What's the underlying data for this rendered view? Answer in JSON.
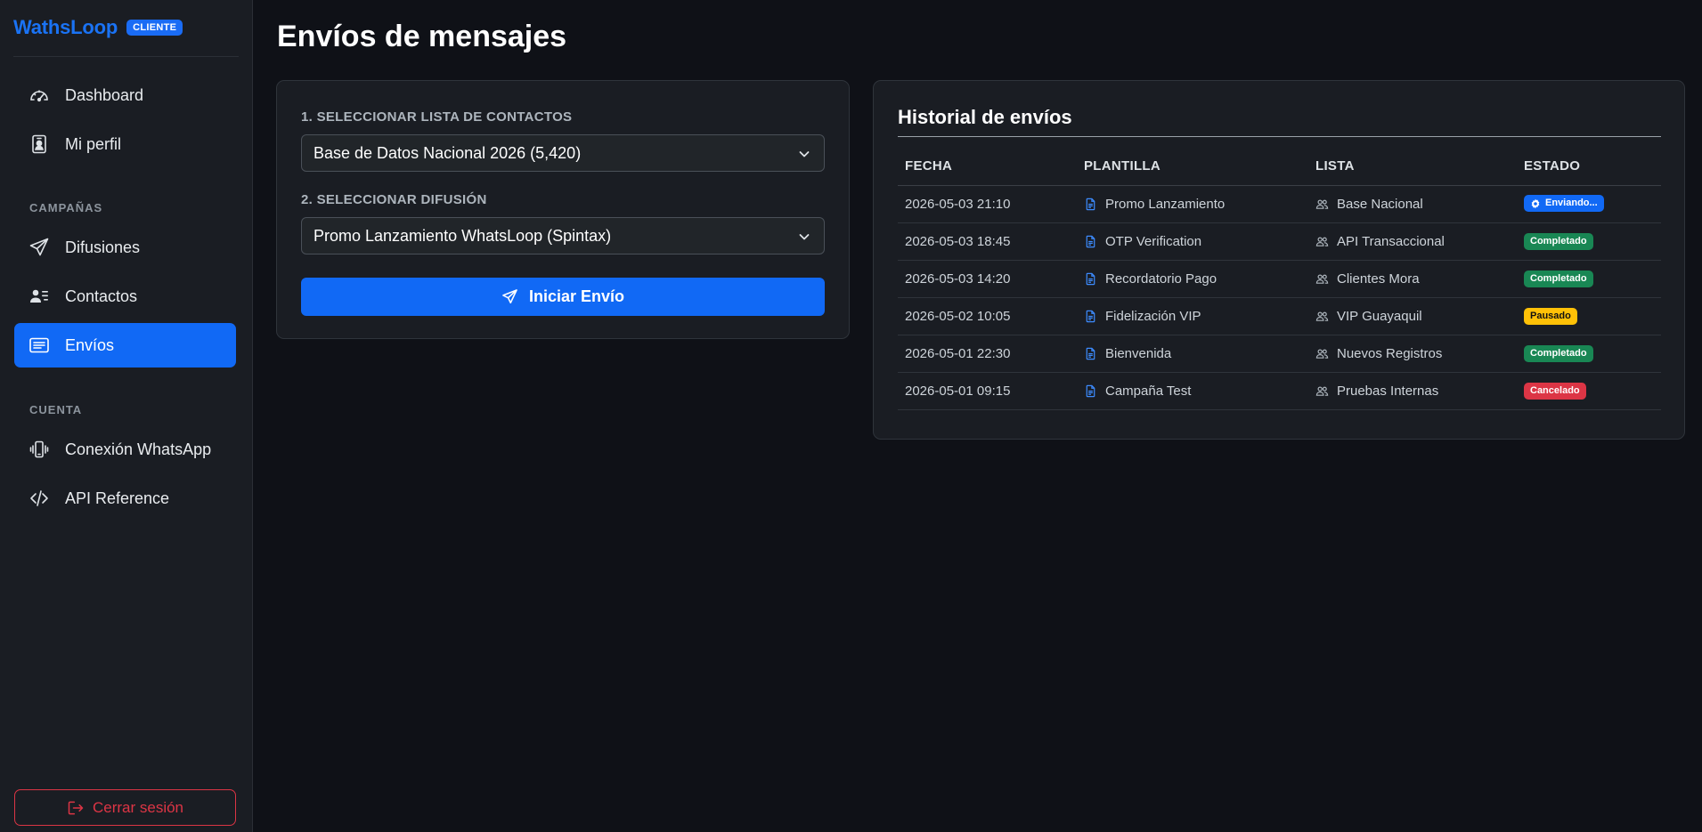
{
  "brand": {
    "name": "WathsLoop",
    "badge": "CLIENTE"
  },
  "sidebar": {
    "items_top": [
      {
        "label": "Dashboard",
        "icon": "speedometer-icon"
      },
      {
        "label": "Mi perfil",
        "icon": "person-badge-icon"
      }
    ],
    "section_campaigns": "CAMPAÑAS",
    "items_campaigns": [
      {
        "label": "Difusiones",
        "icon": "send-icon"
      },
      {
        "label": "Contactos",
        "icon": "person-lines-icon"
      },
      {
        "label": "Envíos",
        "icon": "card-text-icon",
        "active": true
      }
    ],
    "section_account": "CUENTA",
    "items_account": [
      {
        "label": "Conexión WhatsApp",
        "icon": "phone-vibrate-icon"
      },
      {
        "label": "API Reference",
        "icon": "code-icon"
      }
    ],
    "logout": "Cerrar sesión"
  },
  "main": {
    "title": "Envíos de mensajes",
    "form": {
      "list_label": "1. SELECCIONAR LISTA DE CONTACTOS",
      "list_value": "Base de Datos Nacional 2026 (5,420)",
      "broadcast_label": "2. SELECCIONAR DIFUSIÓN",
      "broadcast_value": "Promo Lanzamiento WhatsLoop (Spintax)",
      "submit": "Iniciar Envío"
    },
    "history": {
      "title": "Historial de envíos",
      "columns": [
        "FECHA",
        "PLANTILLA",
        "LISTA",
        "ESTADO"
      ],
      "rows": [
        {
          "date": "2026-05-03 21:10",
          "template": "Promo Lanzamiento",
          "list": "Base Nacional",
          "status": "Enviando...",
          "status_color": "#1169f5",
          "spinner": true
        },
        {
          "date": "2026-05-03 18:45",
          "template": "OTP Verification",
          "list": "API Transaccional",
          "status": "Completado",
          "status_color": "#198754"
        },
        {
          "date": "2026-05-03 14:20",
          "template": "Recordatorio Pago",
          "list": "Clientes Mora",
          "status": "Completado",
          "status_color": "#198754"
        },
        {
          "date": "2026-05-02 10:05",
          "template": "Fidelización VIP",
          "list": "VIP Guayaquil",
          "status": "Pausado",
          "status_color": "#ffc107"
        },
        {
          "date": "2026-05-01 22:30",
          "template": "Bienvenida",
          "list": "Nuevos Registros",
          "status": "Completado",
          "status_color": "#198754"
        },
        {
          "date": "2026-05-01 09:15",
          "template": "Campaña Test",
          "list": "Pruebas Internas",
          "status": "Cancelado",
          "status_color": "#dc3545"
        }
      ]
    }
  },
  "colors": {
    "accent": "#1169f5",
    "danger": "#dc3545",
    "success": "#198754",
    "warning": "#ffc107",
    "bg": "#0f1117",
    "panel": "#1a1d23"
  }
}
